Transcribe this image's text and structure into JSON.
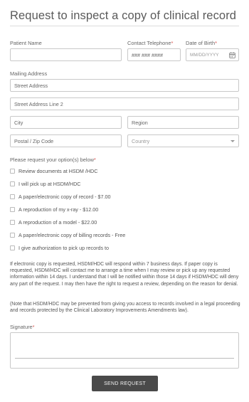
{
  "form": {
    "title": "Request to inspect a copy of clinical record",
    "patient_name_label": "Patient Name",
    "contact_phone_label": "Contact Telephone",
    "contact_phone_placeholder": "### ### ####",
    "dob_label": "Date of Birth",
    "dob_placeholder": "MM/DD/YYYY",
    "mailing_address_label": "Mailing Address",
    "street_address": "Street Address",
    "street_address_2": "Street Address Line 2",
    "city": "City",
    "region": "Region",
    "postal": "Postal / Zip Code",
    "country": "Country",
    "required_mark": "*",
    "options_label": "Please request your option(s) below",
    "options": [
      "Review documents at HSDM /HDC",
      "I will pick up at HSDM/HDC",
      "A paper/electronic copy of record - $7.00",
      "A reproduction of my x-ray - $12.00",
      "A reproduction of a model - $22.00",
      "A paper/electronic copy of billing records - Free",
      "I give authorization to pick up records to"
    ],
    "paragraph_1": "If electronic copy is requested, HSDM/HDC will respond within 7 business days. If paper copy is requested, HSDM/HDC will contact me to arrange a time when I may review or pick up any requested information within 14 days. I understand that I will be notified within those 14 days if HSDM/HDC will deny any part of the request. I may then have the right to request a review, depending on the reason for denial.",
    "paragraph_2": "(Note that HSDM/HDC may be prevented from giving you access to records involved in a legal proceeding and records protected by the Clinical Laboratory Improvements Amendments law).",
    "signature_label": "Signature",
    "submit_label": "SEND REQUEST"
  },
  "icons": {
    "date": "calendar-icon",
    "dropdown": "chevron-down-icon"
  },
  "colors": {
    "required": "#d9534f",
    "button": "#4a4a4a",
    "border": "#c9c9c9"
  }
}
